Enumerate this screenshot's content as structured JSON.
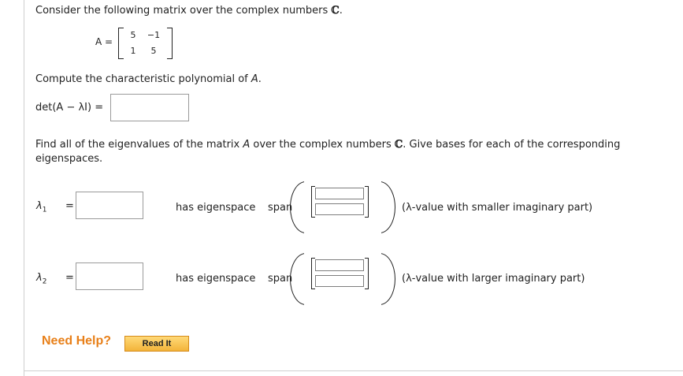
{
  "question_intro": "Consider the following matrix over the complex numbers ",
  "complex_symbol": "ℂ",
  "intro_period": ".",
  "matrix_label": "A =",
  "matrix": [
    [
      "5",
      "−1"
    ],
    [
      "1",
      "5"
    ]
  ],
  "char_poly_prompt_prefix": "Compute the characteristic polynomial of ",
  "char_poly_prompt_var": "A",
  "char_poly_prompt_suffix": ".",
  "det_label": "det(A − λI) =",
  "eigen_prompt_line1_a": "Find all of the eigenvalues of the matrix ",
  "eigen_prompt_var": "A",
  "eigen_prompt_line1_b": " over the complex numbers ",
  "eigen_prompt_line1_c": ". Give bases for each of the corresponding",
  "eigen_prompt_line2": "eigenspaces.",
  "eigen": [
    {
      "symbol": "λ",
      "sub": "1",
      "eq": "=",
      "has_eigenspace": "has eigenspace",
      "span": "span",
      "note": "(λ-value with smaller imaginary part)"
    },
    {
      "symbol": "λ",
      "sub": "2",
      "eq": "=",
      "has_eigenspace": "has eigenspace",
      "span": "span",
      "note": "(λ-value with larger imaginary part)"
    }
  ],
  "help": {
    "label": "Need Help?",
    "read_it": "Read It"
  }
}
